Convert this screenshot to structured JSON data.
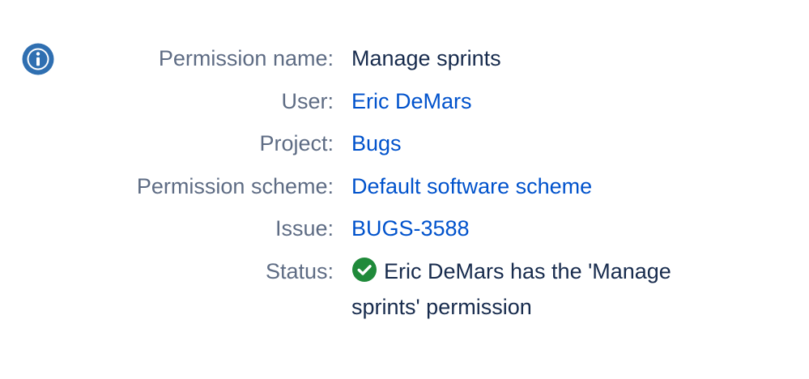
{
  "colors": {
    "label": "#5e6c84",
    "text": "#172b4d",
    "link": "#0052cc",
    "info_icon": "#2f6fb1",
    "success_icon": "#1f8a3a"
  },
  "icons": {
    "info": "info-icon",
    "status": "check-circle-icon"
  },
  "permission": {
    "name_label": "Permission name:",
    "name_value": "Manage sprints",
    "user_label": "User:",
    "user_value": "Eric DeMars",
    "project_label": "Project:",
    "project_value": "Bugs",
    "scheme_label": "Permission scheme:",
    "scheme_value": "Default software scheme",
    "issue_label": "Issue:",
    "issue_value": "BUGS-3588",
    "status_label": "Status:",
    "status_text": "Eric DeMars has the 'Manage sprints' permission"
  }
}
